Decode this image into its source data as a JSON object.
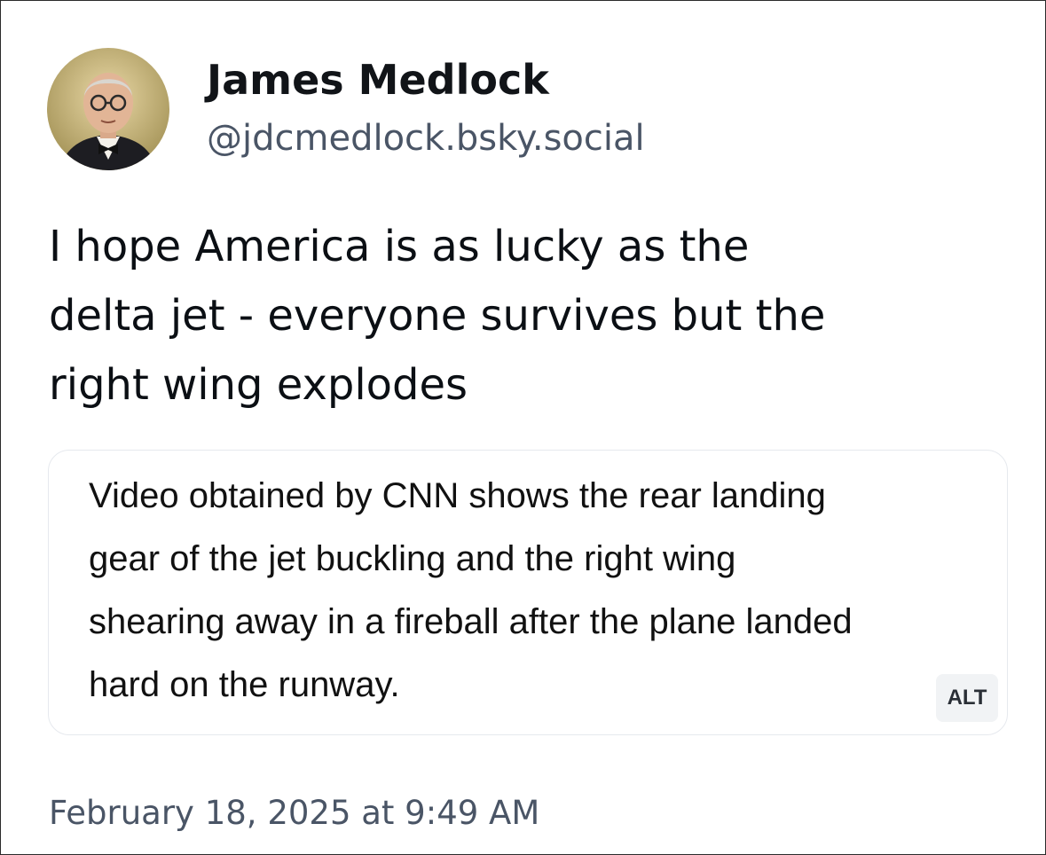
{
  "post": {
    "author": {
      "display_name": "James Medlock",
      "handle": "@jdcmedlock.bsky.social"
    },
    "text": "I hope America is as lucky as the\ndelta jet - everyone survives but the\nright wing explodes",
    "embed": {
      "text": "Video obtained by CNN shows the rear landing\ngear of the jet buckling and the right wing\nshearing away in a fireball after the plane landed\nhard on the runway.",
      "alt_label": "ALT"
    },
    "timestamp": "February 18, 2025 at 9:49 AM"
  },
  "colors": {
    "text_primary": "#0b0f14",
    "text_secondary": "#4a5566",
    "card_border": "#e6e9ee",
    "alt_badge_bg": "#f1f3f5"
  }
}
